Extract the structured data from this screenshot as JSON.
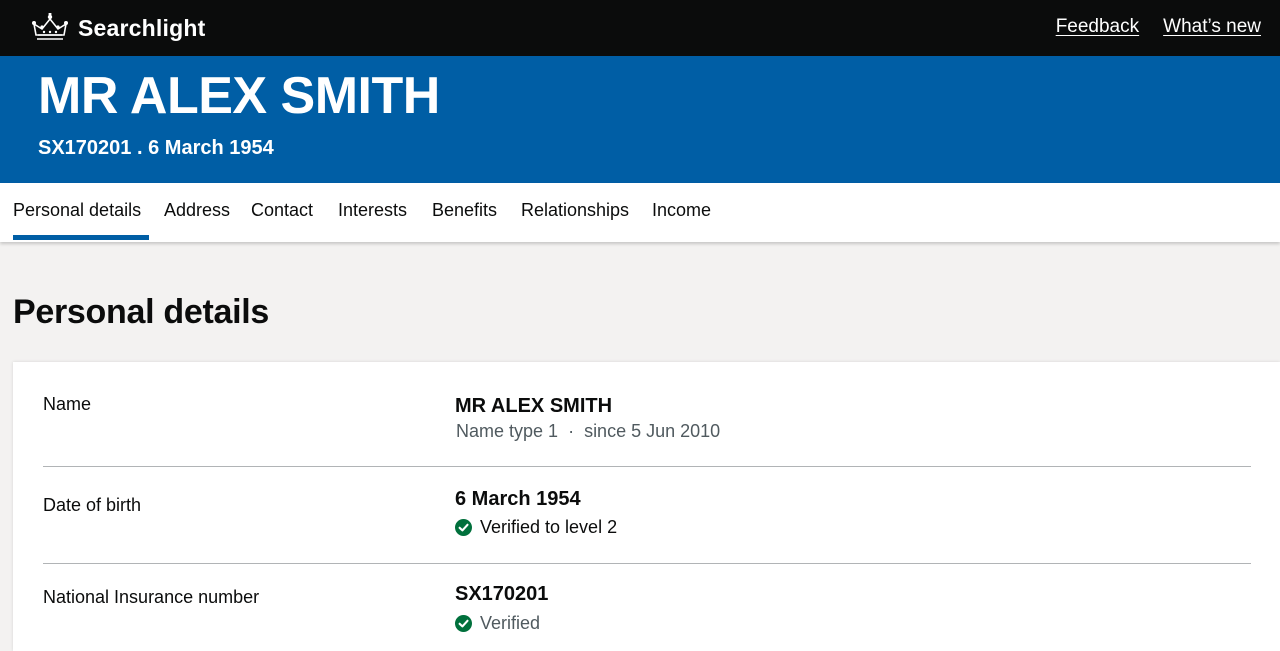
{
  "header": {
    "service_name": "Searchlight",
    "logo_icon": "crown-icon",
    "links": [
      {
        "label": "Feedback"
      },
      {
        "label": "What’s new"
      }
    ]
  },
  "banner": {
    "name": "MR ALEX SMITH",
    "nino": "SX170201",
    "separator": ".",
    "dob": "6 March 1954"
  },
  "tabs": [
    {
      "label": "Personal details",
      "active": true
    },
    {
      "label": "Address"
    },
    {
      "label": "Contact"
    },
    {
      "label": "Interests"
    },
    {
      "label": "Benefits"
    },
    {
      "label": "Relationships"
    },
    {
      "label": "Income"
    }
  ],
  "section": {
    "title": "Personal details"
  },
  "details": {
    "name": {
      "label": "Name",
      "value": "MR ALEX SMITH",
      "name_type": "Name type 1",
      "separator": "·",
      "since": "since 5 Jun 2010"
    },
    "dob": {
      "label": "Date of birth",
      "value": "6 March 1954",
      "status": "Verified to level 2",
      "status_icon": "check-circle-icon"
    },
    "nino": {
      "label": "National Insurance number",
      "value": "SX170201",
      "status": "Verified",
      "status_icon": "check-circle-icon"
    }
  },
  "colors": {
    "header_bg": "#0b0c0c",
    "banner_bg": "#005ea5",
    "tab_indicator": "#005ea5",
    "verified_green": "#00703c",
    "page_bg": "#f3f2f1"
  }
}
